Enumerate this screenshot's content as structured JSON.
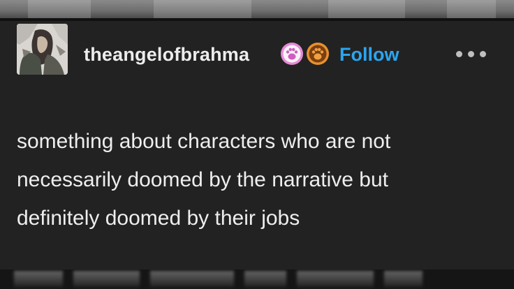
{
  "post": {
    "author": {
      "username": "theangelofbrahma",
      "avatar": "avatar-image",
      "badges": [
        "paw-icon",
        "paw-icon"
      ]
    },
    "follow_label": "Follow",
    "more_menu": "more-options-icon",
    "body": [
      "something about characters who are not",
      "necessarily doomed by the narrative but",
      "definitely doomed by their jobs"
    ]
  },
  "colors": {
    "background": "#222222",
    "text": "#eeeeee",
    "follow": "#2aa6f0",
    "badge_pink": "#e58ad8",
    "badge_orange": "#e8912c"
  }
}
